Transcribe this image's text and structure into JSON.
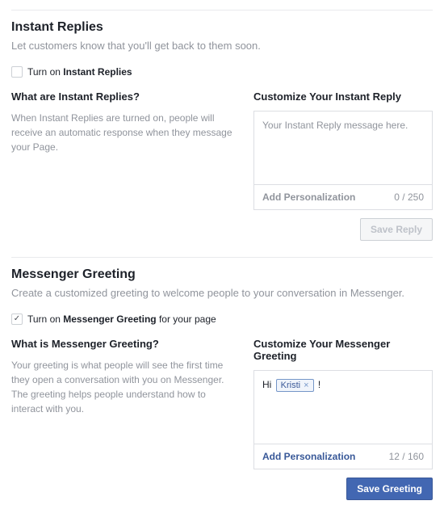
{
  "instant": {
    "title": "Instant Replies",
    "desc": "Let customers know that you'll get back to them soon.",
    "toggle_prefix": "Turn on ",
    "toggle_bold": "Instant Replies",
    "toggle_checked": false,
    "left_title": "What are Instant Replies?",
    "left_text": "When Instant Replies are turned on, people will receive an automatic response when they message your Page.",
    "right_title": "Customize Your Instant Reply",
    "placeholder": "Your Instant Reply message here.",
    "personalize_label": "Add Personalization",
    "counter": "0 / 250",
    "save_label": "Save Reply"
  },
  "greeting": {
    "title": "Messenger Greeting",
    "desc": "Create a customized greeting to welcome people to your conversation in Messenger.",
    "toggle_prefix": "Turn on ",
    "toggle_bold": "Messenger Greeting",
    "toggle_suffix": " for your page",
    "toggle_checked": true,
    "left_title": "What is Messenger Greeting?",
    "left_text": "Your greeting is what people will see the first time they open a conversation with you on Messenger. The greeting helps people understand how to interact with you.",
    "right_title": "Customize Your Messenger Greeting",
    "message_prefix": "Hi ",
    "tag_name": "Kristi",
    "message_suffix": " !",
    "personalize_label": "Add Personalization",
    "counter": "12 / 160",
    "save_label": "Save Greeting"
  }
}
